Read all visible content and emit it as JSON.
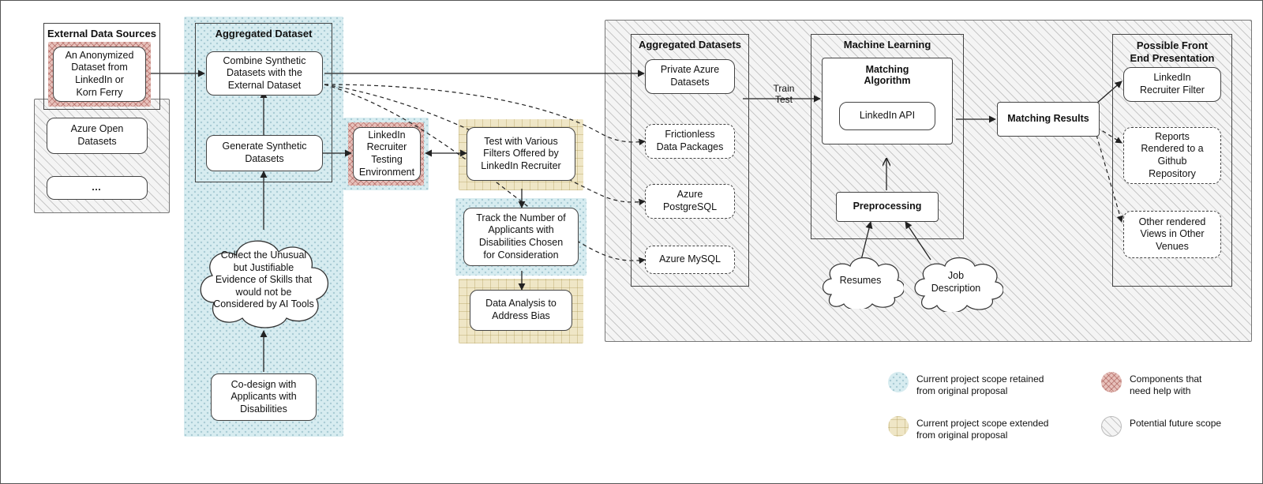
{
  "headers": {
    "externalSources": "External Data Sources",
    "aggregatedDataset": "Aggregated Dataset",
    "aggregatedDatasets": "Aggregated Datasets",
    "machineLearning": "Machine Learning",
    "frontEnd": "Possible Front\nEnd Presentation"
  },
  "nodes": {
    "anonDataset": "An Anonymized\nDataset from\nLinkedIn or\nKorn Ferry",
    "azureOpen": "Azure Open\nDatasets",
    "ellipsis": "…",
    "combine": "Combine Synthetic\nDatasets with the\nExternal Dataset",
    "generate": "Generate Synthetic\nDatasets",
    "recruiterEnv": "LinkedIn\nRecruiter\nTesting\nEnvironment",
    "collectCloud": "Collect the Unusual\nbut Justifiable\nEvidence of Skills that\nwould not be\nConsidered by AI Tools",
    "codesign": "Co-design with\nApplicants with\nDisabilities",
    "testFilters": "Test with Various\nFilters Offered by\nLinkedIn Recruiter",
    "trackNumber": "Track the Number of\nApplicants with\nDisabilities Chosen\nfor Consideration",
    "dataAnalysis": "Data Analysis to\nAddress Bias",
    "privateAzure": "Private Azure\nDatasets",
    "frictionless": "Frictionless\nData Packages",
    "azurePg": "Azure\nPostgreSQL",
    "azureMysql": "Azure MySQL",
    "matchingAlgo": "Matching\nAlgorithm",
    "linkedinApi": "LinkedIn API",
    "preprocessing": "Preprocessing",
    "resumesCloud": "Resumes",
    "jobDescCloud": "Job\nDescription",
    "matchingResults": "Matching Results",
    "recruiterFilter": "LinkedIn\nRecruiter Filter",
    "reportsGithub": "Reports\nRendered to a\nGithub\nRepository",
    "otherViews": "Other rendered\nViews in Other\nVenues"
  },
  "edges": {
    "trainTest": "Train\nTest"
  },
  "legend": {
    "blue": "Current project scope retained\nfrom original proposal",
    "yellow": "Current project scope extended\nfrom original proposal",
    "red": "Components that\nneed help with",
    "grey": "Potential future scope"
  }
}
